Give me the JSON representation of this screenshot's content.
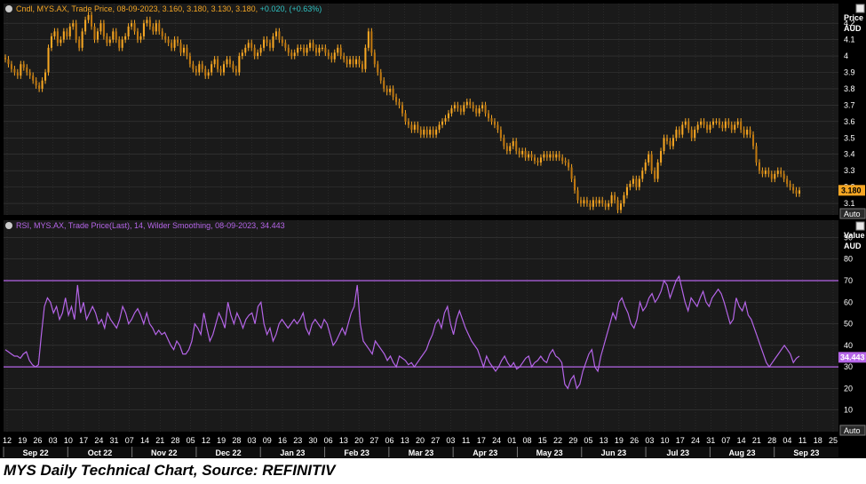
{
  "caption": "MYS Daily Technical Chart, Source: REFINITIV",
  "colors": {
    "price": "#f5a623",
    "rsi": "#b565e8",
    "legend_value": "#2ec4c4",
    "background": "#000000",
    "panel": "#1a1a1a",
    "grid": "#3a3a3a"
  },
  "chart_data": [
    {
      "type": "candlestick",
      "legend": {
        "prefix": "Cndl, MYS.AX, Trade Price, 08-09-2023, 3.160, 3.180, 3.130, 3.180,",
        "change": "+0.020, (+0.63%)"
      },
      "axis_title": "Price",
      "axis_unit": "AUD",
      "auto_label": "Auto",
      "ylim": [
        3.03,
        4.32
      ],
      "yticks": [
        "4.2",
        "4.1",
        "4",
        "3.9",
        "3.8",
        "3.7",
        "3.6",
        "3.5",
        "3.4",
        "3.3",
        "3.2",
        "3.1"
      ],
      "last_value": "3.180",
      "close_series": [
        3.98,
        3.95,
        3.92,
        3.9,
        3.88,
        3.95,
        3.93,
        3.9,
        3.88,
        3.85,
        3.82,
        3.8,
        3.85,
        3.9,
        4.05,
        4.12,
        4.15,
        4.08,
        4.1,
        4.15,
        4.12,
        4.18,
        4.2,
        4.1,
        4.05,
        4.15,
        4.22,
        4.25,
        4.18,
        4.1,
        4.15,
        4.2,
        4.12,
        4.08,
        4.1,
        4.15,
        4.1,
        4.05,
        4.1,
        4.12,
        4.18,
        4.2,
        4.15,
        4.1,
        4.12,
        4.2,
        4.22,
        4.18,
        4.15,
        4.2,
        4.15,
        4.12,
        4.1,
        4.08,
        4.05,
        4.1,
        4.08,
        4.02,
        4.05,
        4.0,
        3.95,
        3.92,
        3.9,
        3.95,
        3.92,
        3.88,
        3.9,
        3.95,
        3.98,
        3.92,
        3.9,
        3.95,
        3.98,
        3.95,
        3.92,
        3.9,
        4.0,
        4.02,
        4.05,
        4.08,
        4.05,
        4.0,
        4.02,
        4.05,
        4.1,
        4.08,
        4.05,
        4.12,
        4.15,
        4.1,
        4.08,
        4.05,
        4.02,
        4.0,
        4.02,
        4.05,
        4.05,
        4.02,
        4.05,
        4.08,
        4.05,
        4.02,
        4.05,
        4.05,
        4.02,
        4.0,
        3.98,
        4.02,
        4.05,
        4.0,
        3.98,
        3.95,
        3.98,
        3.95,
        3.98,
        3.95,
        3.92,
        4.05,
        4.15,
        4.02,
        3.95,
        3.9,
        3.85,
        3.8,
        3.78,
        3.8,
        3.75,
        3.72,
        3.7,
        3.65,
        3.6,
        3.58,
        3.55,
        3.58,
        3.55,
        3.52,
        3.55,
        3.52,
        3.55,
        3.52,
        3.55,
        3.58,
        3.6,
        3.62,
        3.65,
        3.68,
        3.7,
        3.68,
        3.66,
        3.7,
        3.72,
        3.7,
        3.68,
        3.65,
        3.68,
        3.7,
        3.65,
        3.62,
        3.6,
        3.58,
        3.55,
        3.5,
        3.45,
        3.42,
        3.45,
        3.48,
        3.42,
        3.4,
        3.42,
        3.38,
        3.4,
        3.38,
        3.36,
        3.35,
        3.38,
        3.4,
        3.38,
        3.4,
        3.38,
        3.4,
        3.38,
        3.36,
        3.35,
        3.32,
        3.25,
        3.18,
        3.12,
        3.1,
        3.12,
        3.1,
        3.08,
        3.12,
        3.1,
        3.12,
        3.1,
        3.08,
        3.1,
        3.15,
        3.12,
        3.06,
        3.1,
        3.15,
        3.2,
        3.22,
        3.25,
        3.2,
        3.25,
        3.3,
        3.35,
        3.4,
        3.3,
        3.25,
        3.35,
        3.42,
        3.5,
        3.48,
        3.45,
        3.5,
        3.55,
        3.52,
        3.58,
        3.6,
        3.55,
        3.5,
        3.55,
        3.58,
        3.6,
        3.58,
        3.55,
        3.58,
        3.6,
        3.6,
        3.58,
        3.56,
        3.6,
        3.58,
        3.55,
        3.58,
        3.6,
        3.55,
        3.52,
        3.55,
        3.52,
        3.45,
        3.35,
        3.3,
        3.28,
        3.3,
        3.28,
        3.25,
        3.28,
        3.3,
        3.28,
        3.25,
        3.22,
        3.2,
        3.18,
        3.16,
        3.18
      ]
    },
    {
      "type": "line",
      "legend": {
        "text": "RSI, MYS.AX, Trade Price(Last), 14, Wilder Smoothing, 08-09-2023, 34.443"
      },
      "axis_title": "Value",
      "axis_unit": "AUD",
      "auto_label": "Auto",
      "ylim": [
        0,
        98
      ],
      "yticks": [
        "90",
        "80",
        "70",
        "60",
        "50",
        "40",
        "30",
        "20",
        "10"
      ],
      "reference_lines": [
        70,
        30
      ],
      "last_value": "34.443",
      "values": [
        38,
        37,
        36,
        35,
        35,
        34,
        36,
        37,
        33,
        31,
        30,
        31,
        45,
        58,
        62,
        60,
        55,
        58,
        52,
        55,
        62,
        54,
        58,
        52,
        68,
        55,
        60,
        52,
        55,
        58,
        55,
        50,
        52,
        48,
        55,
        52,
        50,
        48,
        52,
        58,
        55,
        50,
        52,
        55,
        57,
        54,
        50,
        55,
        50,
        48,
        45,
        47,
        45,
        46,
        43,
        40,
        38,
        42,
        40,
        36,
        36,
        38,
        42,
        50,
        48,
        45,
        55,
        48,
        42,
        45,
        50,
        55,
        52,
        48,
        60,
        54,
        50,
        55,
        52,
        48,
        52,
        54,
        55,
        50,
        58,
        60,
        50,
        45,
        48,
        42,
        45,
        50,
        52,
        50,
        48,
        50,
        52,
        50,
        52,
        55,
        48,
        45,
        50,
        52,
        50,
        48,
        52,
        50,
        45,
        40,
        42,
        45,
        48,
        45,
        50,
        55,
        58,
        68,
        50,
        42,
        40,
        38,
        36,
        42,
        40,
        38,
        36,
        33,
        35,
        32,
        30,
        35,
        34,
        33,
        31,
        32,
        30,
        32,
        34,
        36,
        38,
        42,
        45,
        50,
        52,
        48,
        55,
        58,
        50,
        45,
        52,
        56,
        52,
        48,
        45,
        42,
        40,
        38,
        34,
        30,
        35,
        32,
        30,
        28,
        30,
        33,
        35,
        32,
        30,
        32,
        29,
        30,
        32,
        34,
        35,
        30,
        32,
        33,
        35,
        33,
        32,
        36,
        38,
        35,
        34,
        32,
        22,
        20,
        24,
        26,
        20,
        22,
        28,
        32,
        36,
        38,
        30,
        28,
        35,
        40,
        45,
        50,
        55,
        52,
        60,
        62,
        58,
        55,
        50,
        48,
        52,
        60,
        56,
        58,
        62,
        64,
        60,
        62,
        65,
        70,
        68,
        62,
        66,
        70,
        72,
        66,
        60,
        56,
        62,
        60,
        58,
        62,
        65,
        60,
        58,
        62,
        64,
        66,
        64,
        60,
        55,
        50,
        52,
        62,
        58,
        56,
        60,
        54,
        52,
        48,
        44,
        40,
        36,
        32,
        30,
        32,
        34,
        36,
        38,
        40,
        38,
        36,
        32,
        34,
        35
      ]
    }
  ],
  "xaxis": {
    "days": [
      "12",
      "19",
      "26",
      "03",
      "10",
      "17",
      "24",
      "31",
      "07",
      "14",
      "21",
      "28",
      "05",
      "12",
      "19",
      "28",
      "03",
      "09",
      "16",
      "23",
      "30",
      "06",
      "13",
      "20",
      "27",
      "06",
      "13",
      "20",
      "27",
      "03",
      "11",
      "17",
      "24",
      "01",
      "08",
      "15",
      "22",
      "29",
      "05",
      "13",
      "19",
      "26",
      "03",
      "10",
      "17",
      "24",
      "31",
      "07",
      "14",
      "21",
      "28",
      "04",
      "11",
      "18",
      "25"
    ],
    "months": [
      "Sep 22",
      "Oct 22",
      "Nov 22",
      "Dec 22",
      "Jan 23",
      "Feb 23",
      "Mar 23",
      "Apr 23",
      "May 23",
      "Jun 23",
      "Jul 23",
      "Aug 23",
      "Sep 23"
    ]
  }
}
